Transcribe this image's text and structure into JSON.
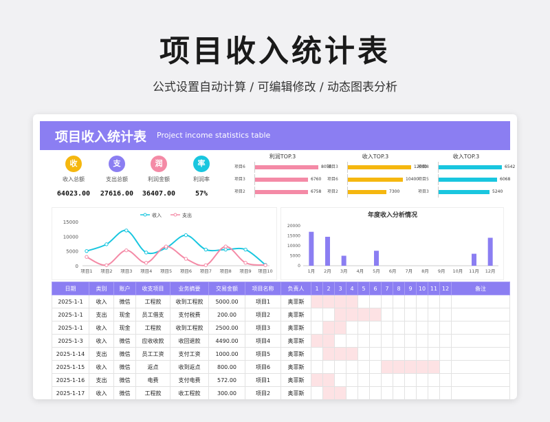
{
  "header": {
    "title": "项目收入统计表",
    "subtitle": "公式设置自动计算 /  可编辑修改  / 动态图表分析"
  },
  "banner": {
    "title": "项目收入统计表",
    "subtitle": "Project income statistics table"
  },
  "kpis": [
    {
      "icon_text": "收",
      "label": "收入总额",
      "value": "64023.00",
      "color": "#f5b70f"
    },
    {
      "icon_text": "支",
      "label": "支出总额",
      "value": "27616.00",
      "color": "#8b7ef2"
    },
    {
      "icon_text": "润",
      "label": "利润金额",
      "value": "36407.00",
      "color": "#f48aa6"
    },
    {
      "icon_text": "率",
      "label": "利润率",
      "value": "57%",
      "color": "#19c6df"
    }
  ],
  "top3": [
    {
      "title": "利润TOP.3",
      "color": "#f48aa6",
      "max": 8058,
      "items": [
        {
          "label": "项目6",
          "value": 8058
        },
        {
          "label": "项目3",
          "value": 6760
        },
        {
          "label": "项目2",
          "value": 6758
        }
      ]
    },
    {
      "title": "收入TOP.3",
      "color": "#f5b70f",
      "max": 12000,
      "items": [
        {
          "label": "项目3",
          "value": 12000
        },
        {
          "label": "项目6",
          "value": 10400
        },
        {
          "label": "项目2",
          "value": 7300
        }
      ]
    },
    {
      "title": "收入TOP.3",
      "color": "#19c6df",
      "max": 6542,
      "items": [
        {
          "label": "项目8",
          "value": 6542
        },
        {
          "label": "项目5",
          "value": 6068
        },
        {
          "label": "项目3",
          "value": 5240
        }
      ]
    }
  ],
  "chart_data": [
    {
      "type": "line",
      "title": "",
      "categories": [
        "项目1",
        "项目2",
        "项目3",
        "项目4",
        "项目5",
        "项目6",
        "项目7",
        "项目8",
        "项目9",
        "项目10"
      ],
      "series": [
        {
          "name": "收入",
          "values": [
            5000,
            7300,
            12000,
            4490,
            6068,
            10400,
            5500,
            5500,
            5500,
            300
          ],
          "color": "#19c6df"
        },
        {
          "name": "支出",
          "values": [
            3000,
            200,
            5240,
            1000,
            6542,
            2342,
            200,
            6542,
            1000,
            200
          ],
          "color": "#f48aa6"
        }
      ],
      "yticks": [
        0,
        5000,
        10000,
        15000
      ],
      "ytick_labels": [
        "0",
        "5000",
        "10000",
        "15000"
      ],
      "ylim": [
        0,
        15000
      ],
      "legend": "top"
    },
    {
      "type": "bar",
      "title": "年度收入分析情况",
      "categories": [
        "1月",
        "2月",
        "3月",
        "4月",
        "5月",
        "6月",
        "7月",
        "8月",
        "9月",
        "10月",
        "11月",
        "12月"
      ],
      "values": [
        17000,
        14500,
        5000,
        0,
        7500,
        0,
        0,
        0,
        0,
        0,
        6000,
        14000
      ],
      "yticks": [
        0,
        5000,
        10000,
        15000,
        20000
      ],
      "ylim": [
        0,
        20000
      ],
      "color": "#8b7ef2"
    }
  ],
  "table": {
    "headers": [
      "日期",
      "类别",
      "账户",
      "收支项目",
      "业务摘要",
      "交易金额",
      "项目名称",
      "负责人",
      "1",
      "2",
      "3",
      "4",
      "5",
      "6",
      "7",
      "8",
      "9",
      "10",
      "11",
      "12",
      "备注"
    ],
    "rows": [
      {
        "cells": [
          "2025-1-1",
          "收入",
          "微信",
          "工程款",
          "收到工程款",
          "5000.00",
          "项目1",
          "奥菲斯"
        ],
        "marks": [
          1,
          2,
          3,
          4
        ]
      },
      {
        "cells": [
          "2025-1-1",
          "支出",
          "现金",
          "员工借支",
          "支付税费",
          "200.00",
          "项目2",
          "奥菲斯"
        ],
        "marks": [
          3,
          4,
          5,
          6
        ]
      },
      {
        "cells": [
          "2025-1-1",
          "收入",
          "现金",
          "工程款",
          "收到工程款",
          "2500.00",
          "项目3",
          "奥菲斯"
        ],
        "marks": [
          2,
          3
        ]
      },
      {
        "cells": [
          "2025-1-3",
          "收入",
          "微信",
          "应收收款",
          "收回退款",
          "4490.00",
          "项目4",
          "奥菲斯"
        ],
        "marks": [
          1,
          2
        ]
      },
      {
        "cells": [
          "2025-1-14",
          "支出",
          "微信",
          "员工工资",
          "支付工资",
          "1000.00",
          "项目5",
          "奥菲斯"
        ],
        "marks": [
          2,
          3,
          4
        ]
      },
      {
        "cells": [
          "2025-1-15",
          "收入",
          "微信",
          "返点",
          "收到返点",
          "800.00",
          "项目6",
          "奥菲斯"
        ],
        "marks": [
          7,
          8,
          9,
          10,
          11
        ]
      },
      {
        "cells": [
          "2025-1-16",
          "支出",
          "微信",
          "电费",
          "支付电费",
          "572.00",
          "项目1",
          "奥菲斯"
        ],
        "marks": [
          1,
          2
        ]
      },
      {
        "cells": [
          "2025-1-17",
          "收入",
          "微信",
          "工程款",
          "收工程款",
          "300.00",
          "项目2",
          "奥菲斯"
        ],
        "marks": [
          2,
          3
        ]
      }
    ]
  }
}
